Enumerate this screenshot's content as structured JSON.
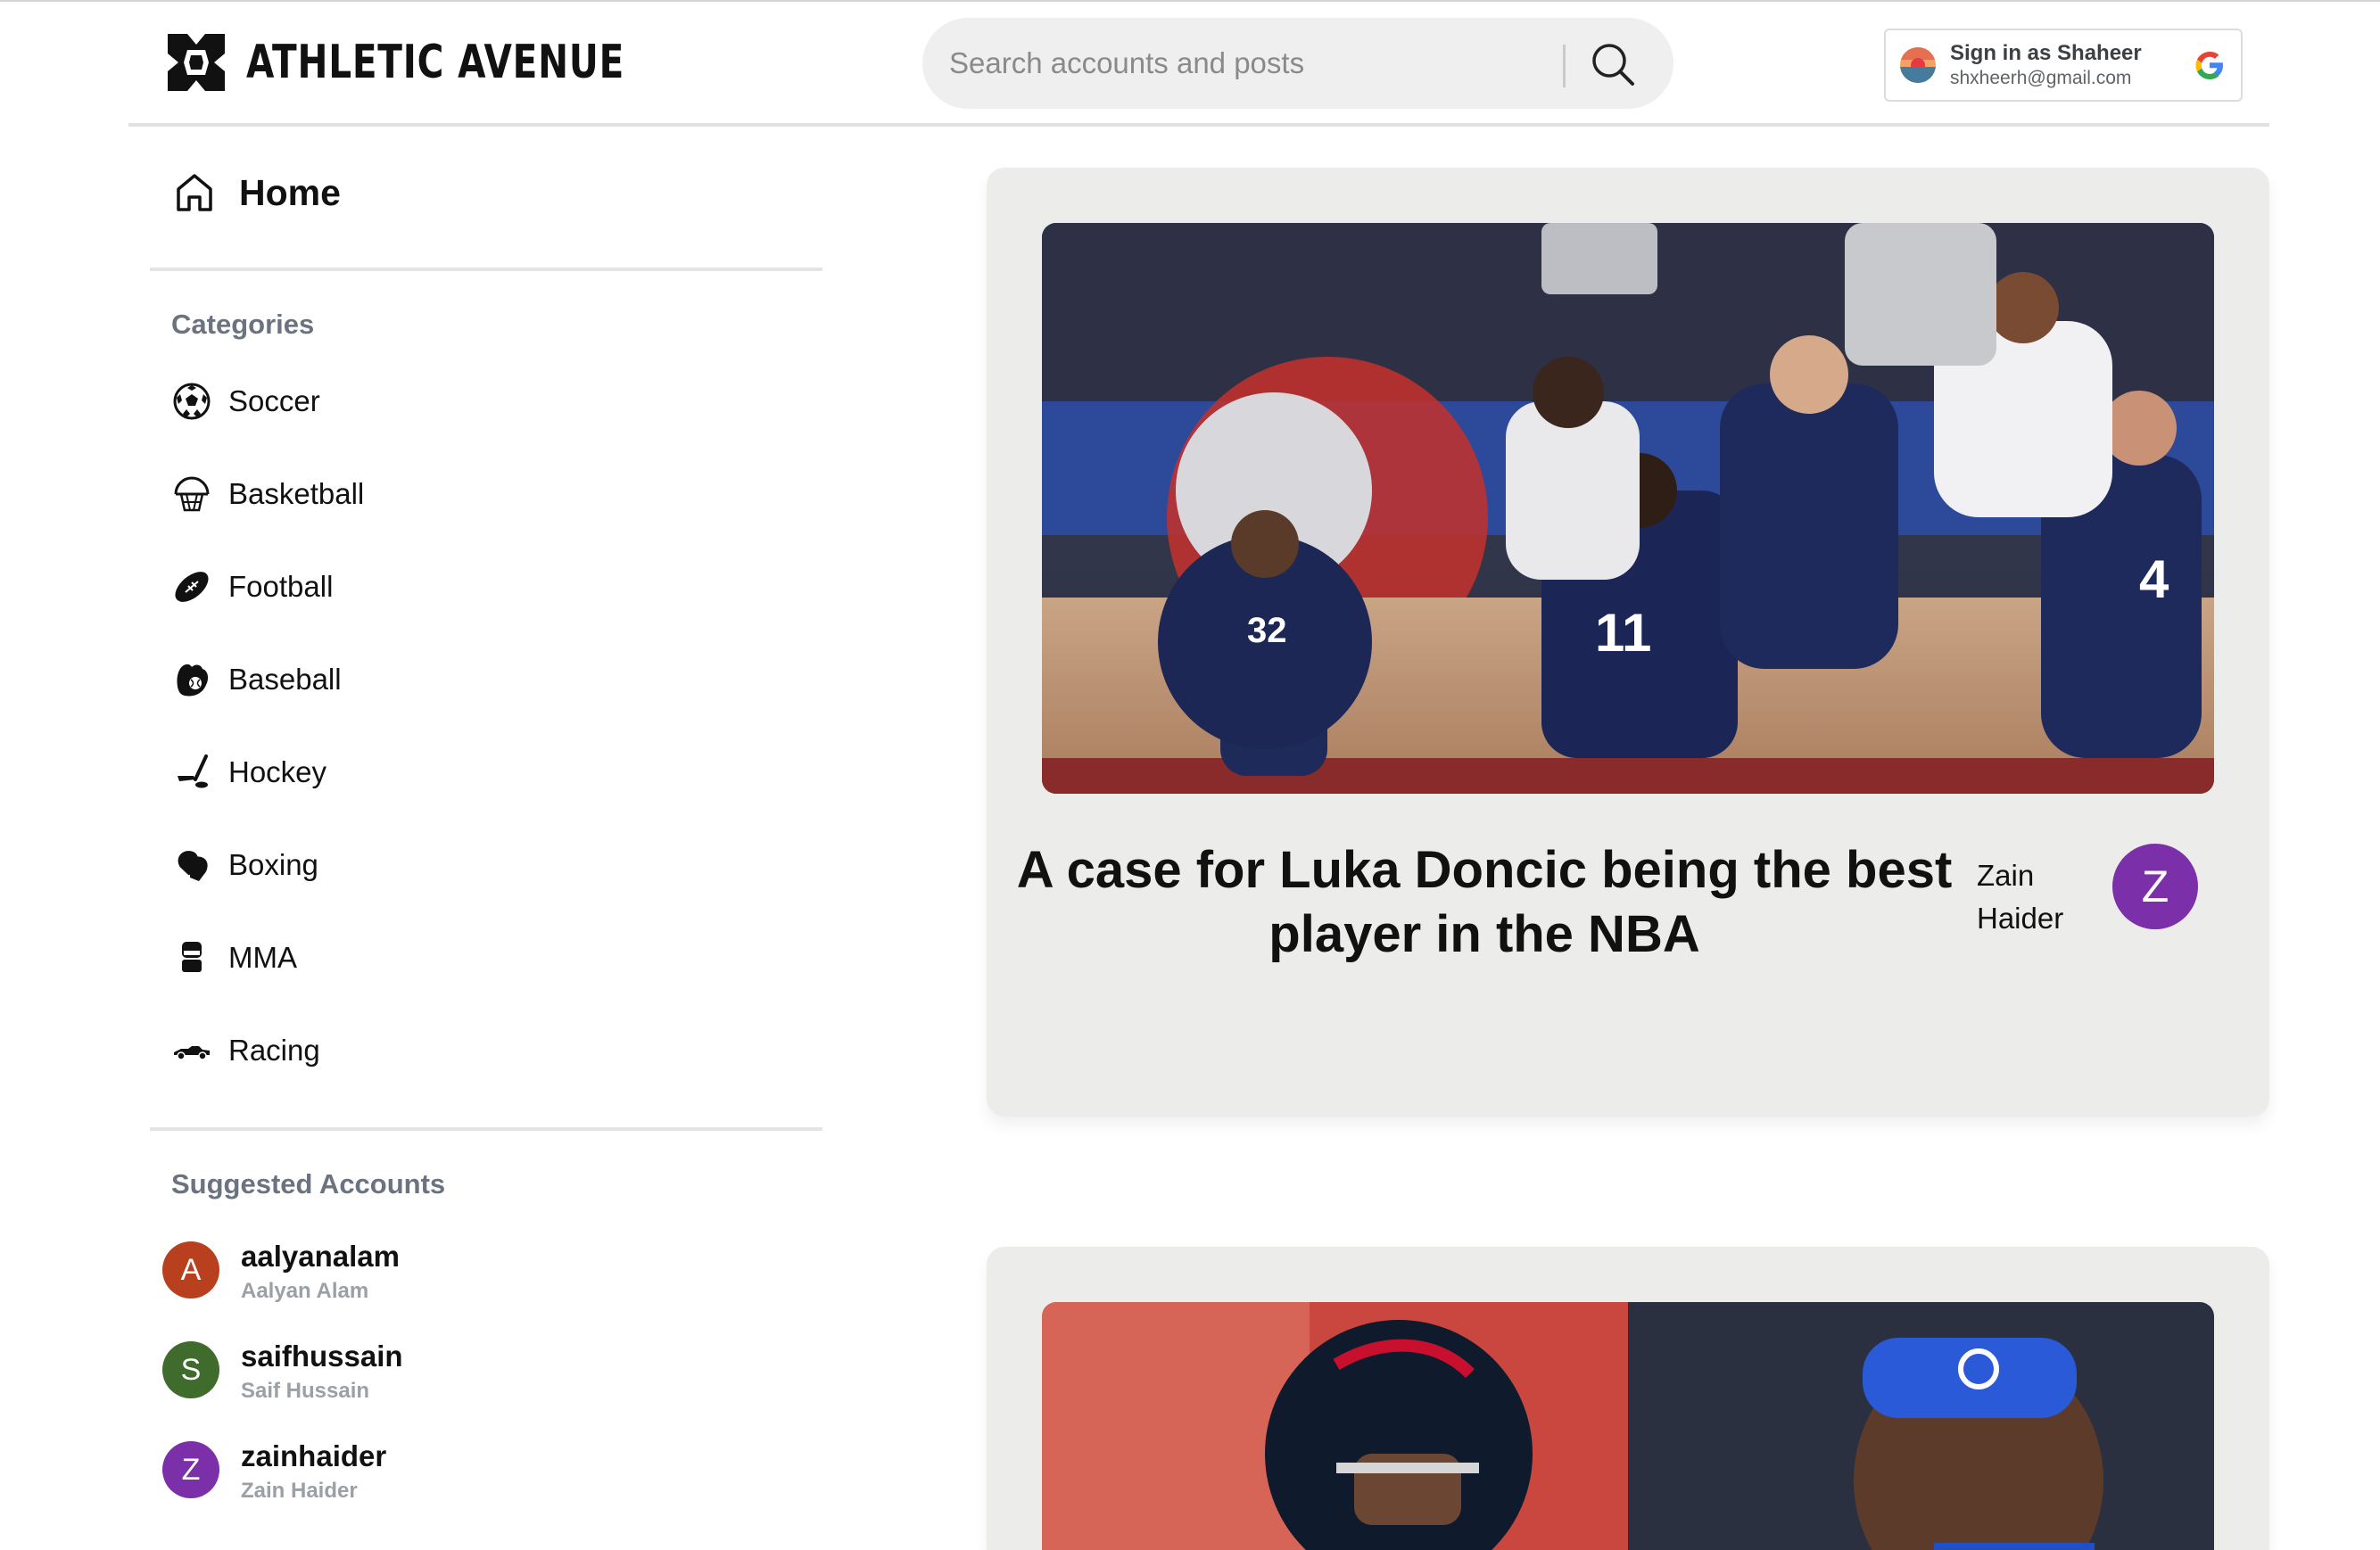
{
  "header": {
    "brand": "ATHLETIC AVENUE",
    "search_placeholder": "Search accounts and posts",
    "signin": {
      "title": "Sign in as Shaheer",
      "email": "shxheerh@gmail.com"
    }
  },
  "sidebar": {
    "home_label": "Home",
    "categories_title": "Categories",
    "categories": [
      {
        "label": "Soccer",
        "icon": "soccer-ball-icon"
      },
      {
        "label": "Basketball",
        "icon": "basketball-hoop-icon"
      },
      {
        "label": "Football",
        "icon": "football-icon"
      },
      {
        "label": "Baseball",
        "icon": "baseball-glove-icon"
      },
      {
        "label": "Hockey",
        "icon": "hockey-stick-icon"
      },
      {
        "label": "Boxing",
        "icon": "boxing-glove-icon"
      },
      {
        "label": "MMA",
        "icon": "mma-glove-icon"
      },
      {
        "label": "Racing",
        "icon": "race-car-icon"
      }
    ],
    "suggested_title": "Suggested Accounts",
    "accounts": [
      {
        "initial": "A",
        "username": "aalyanalam",
        "name": "Aalyan Alam",
        "color": "#b9401e"
      },
      {
        "initial": "S",
        "username": "saifhussain",
        "name": "Saif Hussain",
        "color": "#3f6b2c"
      },
      {
        "initial": "Z",
        "username": "zainhaider",
        "name": "Zain Haider",
        "color": "#7b2fa8"
      }
    ]
  },
  "feed": {
    "posts": [
      {
        "title_line1": "A case for Luka Doncic being the best",
        "title_line2": "player in the NBA",
        "author_first": "Zain",
        "author_last": "Haider",
        "author_initial": "Z",
        "author_color": "#7b2fa8"
      }
    ]
  },
  "colors": {
    "card_bg": "#ececea",
    "muted_text": "#6b7280"
  }
}
